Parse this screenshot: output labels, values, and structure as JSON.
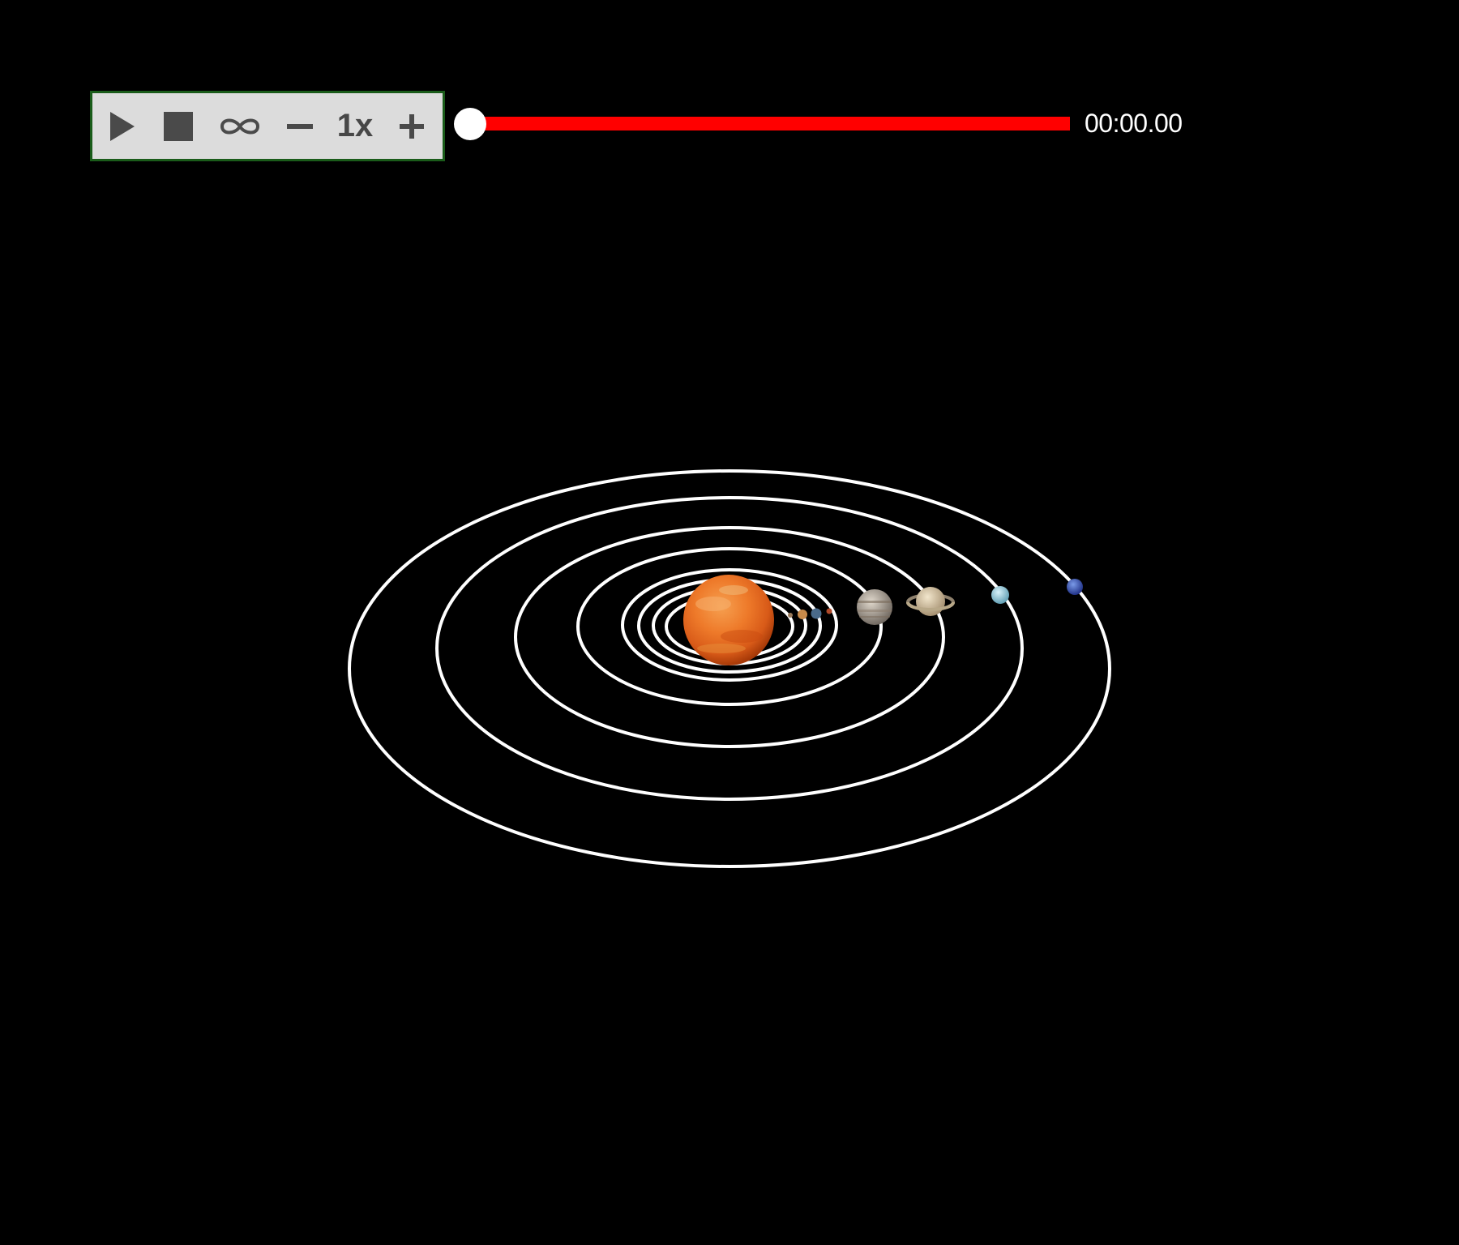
{
  "controls": {
    "play_icon": "play-icon",
    "stop_icon": "stop-icon",
    "loop_icon": "infinity-icon",
    "slower_icon": "minus-icon",
    "speed": "1x",
    "faster_icon": "plus-icon"
  },
  "timeline": {
    "progress": 0,
    "time": "00:00.00",
    "track_color": "#ff0000",
    "knob_color": "#ffffff"
  },
  "scene": {
    "background": "#000000",
    "orbit_color": "#ffffff",
    "bodies": [
      {
        "name": "sun",
        "color": "#f07a1e"
      },
      {
        "name": "mercury",
        "color": "#9a7a5a"
      },
      {
        "name": "venus",
        "color": "#c88a4a"
      },
      {
        "name": "earth",
        "color": "#4a6a8a"
      },
      {
        "name": "mars",
        "color": "#b04a2a"
      },
      {
        "name": "jupiter",
        "color": "#b8aa98"
      },
      {
        "name": "saturn",
        "color": "#d8c8a8"
      },
      {
        "name": "uranus",
        "color": "#9ad0e0"
      },
      {
        "name": "neptune",
        "color": "#3050b0"
      }
    ]
  }
}
